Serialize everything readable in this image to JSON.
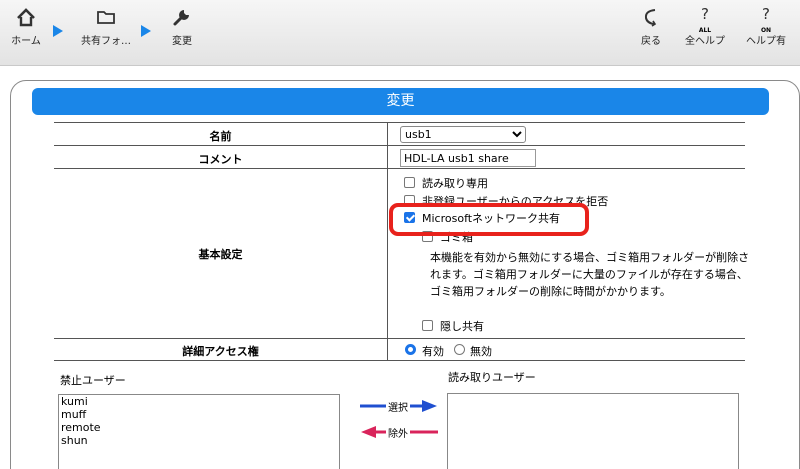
{
  "toolbar": {
    "home_label": "ホーム",
    "share_label": "共有フォ…",
    "change_label": "変更",
    "back_label": "戻る",
    "all_help_label": "全ヘルプ",
    "all_help_badge": "ALL",
    "help_on_label": "ヘルプ有",
    "help_on_badge": "ON"
  },
  "form": {
    "title": "変更",
    "name_label": "名前",
    "name_value": "usb1",
    "comment_label": "コメント",
    "comment_value": "HDL-LA usb1 share",
    "basic_label": "基本設定",
    "opt_readonly": "読み取り専用",
    "opt_deny_unregistered": "非登録ユーザーからのアクセスを拒否",
    "opt_ms_network": "Microsoftネットワーク共有",
    "opt_trash": "ゴミ箱",
    "trash_note": "本機能を有効から無効にする場合、ゴミ箱用フォルダーが削除されます。ゴミ箱用フォルダーに大量のファイルが存在する場合、ゴミ箱用フォルダーの削除に時間がかかります。",
    "opt_hidden": "隠し共有",
    "access_label": "詳細アクセス権",
    "access_enabled": "有効",
    "access_disabled": "無効",
    "banned_users_label": "禁止ユーザー",
    "banned_users": [
      "kumi",
      "muff",
      "remote",
      "shun"
    ],
    "read_users_label": "読み取りユーザー",
    "select_button": "選択",
    "remove_button": "除外"
  },
  "colors": {
    "accent_blue": "#1a86e8",
    "highlight_red": "#e8221c"
  }
}
